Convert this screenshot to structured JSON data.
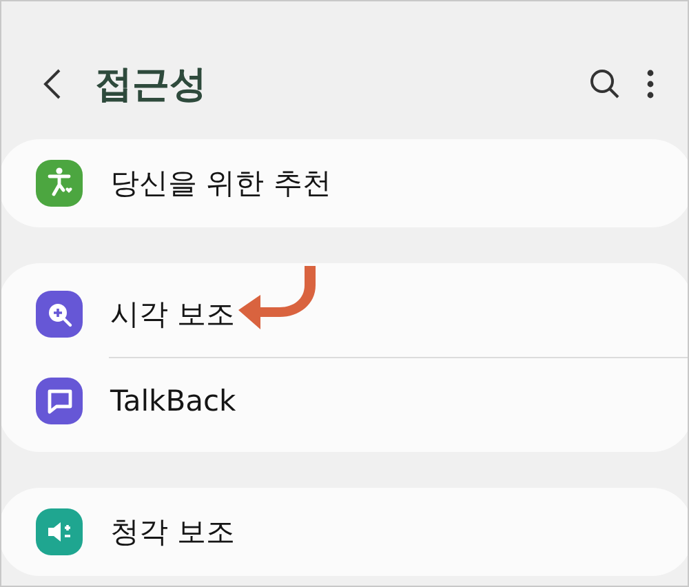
{
  "header": {
    "title": "접근성"
  },
  "groups": [
    {
      "items": [
        {
          "label": "당신을 위한 추천",
          "color": "#4ca640"
        }
      ]
    },
    {
      "items": [
        {
          "label": "시각 보조",
          "color": "#6657d6"
        },
        {
          "label": "TalkBack",
          "color": "#6657d6"
        }
      ]
    },
    {
      "items": [
        {
          "label": "청각 보조",
          "color": "#1fa690"
        }
      ]
    }
  ]
}
